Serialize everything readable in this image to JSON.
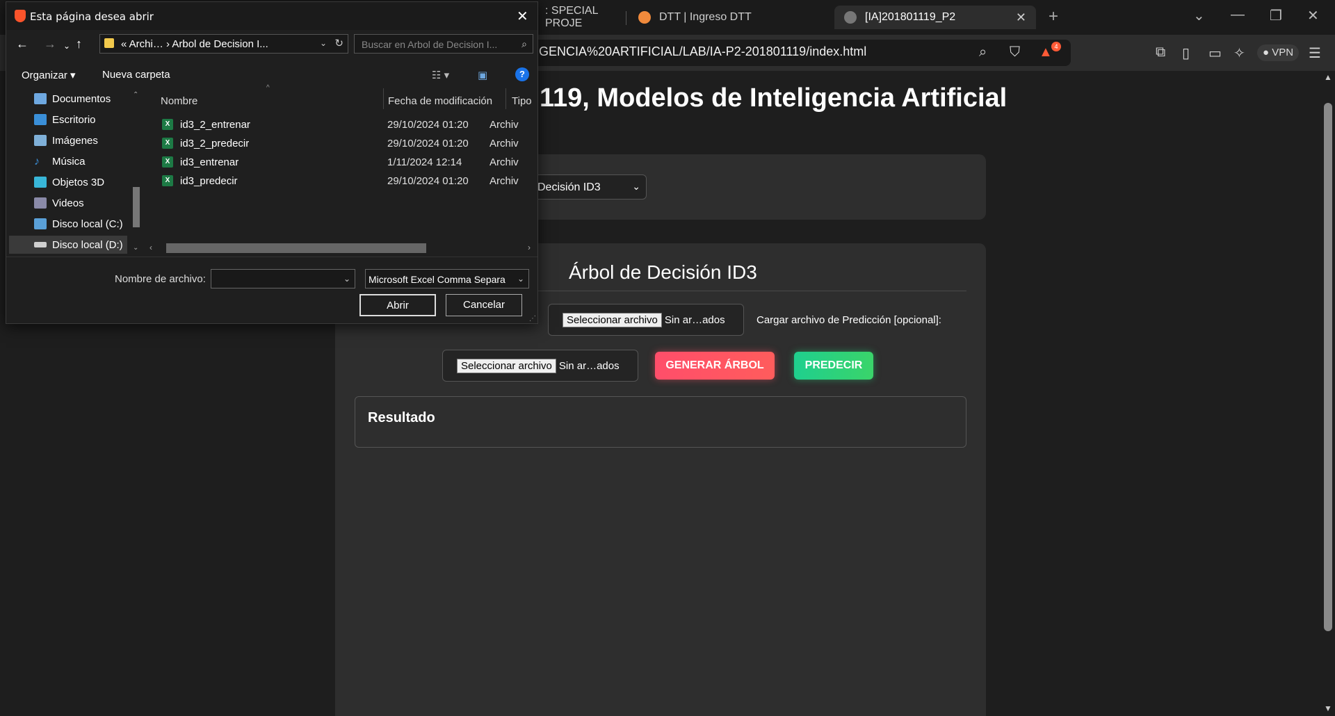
{
  "browser": {
    "tabs": [
      {
        "label": ": SPECIAL PROJE",
        "active": false
      },
      {
        "label": "DTT | Ingreso DTT",
        "active": false
      },
      {
        "label": "[IA]201801119_P2",
        "active": true
      }
    ],
    "url": "GENCIA%20ARTIFICIAL/LAB/IA-P2-201801119/index.html",
    "shields_count": "4",
    "vpn_label": "VPN",
    "icons": [
      "zoom-icon",
      "brave-shield-icon",
      "rewards-icon",
      "extensions-icon",
      "sidebar-icon",
      "wallet-icon",
      "leo-icon",
      "menu-icon"
    ]
  },
  "page": {
    "title": "119, Modelos de Inteligencia Artificial",
    "algorithm_select": "Decisión ID3",
    "section_title": "Árbol de Decisión ID3",
    "file_input_1": {
      "button": "Seleccionar archivo",
      "status": "Sin ar…ados"
    },
    "prediction_label": "Cargar archivo de Predicción [opcional]:",
    "file_input_2": {
      "button": "Seleccionar archivo",
      "status": "Sin ar…ados"
    },
    "btn_generate": "GENERAR ÁRBOL",
    "btn_predict": "PREDECIR",
    "result_title": "Resultado"
  },
  "dialog": {
    "title": "Esta página desea abrir",
    "path": "« Archi…  ›  Arbol de Decision I...",
    "search_placeholder": "Buscar en Arbol de Decision I...",
    "organize": "Organizar ▾",
    "new_folder": "Nueva carpeta",
    "sidebar": [
      {
        "label": "Documentos",
        "color": "#6ea8e0"
      },
      {
        "label": "Escritorio",
        "color": "#3a8fd8"
      },
      {
        "label": "Imágenes",
        "color": "#7fb0d8"
      },
      {
        "label": "Música",
        "color": "#3a8fd8"
      },
      {
        "label": "Objetos 3D",
        "color": "#38b6d8"
      },
      {
        "label": "Videos",
        "color": "#8a8aa8"
      },
      {
        "label": "Disco local (C:)",
        "color": "#5aa0d8"
      },
      {
        "label": "Disco local (D:)",
        "color": "#cfcfcf"
      }
    ],
    "columns": {
      "name": "Nombre",
      "date": "Fecha de modificación",
      "type": "Tipo"
    },
    "files": [
      {
        "name": "id3_2_entrenar",
        "date": "29/10/2024 01:20",
        "type": "Archiv"
      },
      {
        "name": "id3_2_predecir",
        "date": "29/10/2024 01:20",
        "type": "Archiv"
      },
      {
        "name": "id3_entrenar",
        "date": "1/11/2024 12:14",
        "type": "Archiv"
      },
      {
        "name": "id3_predecir",
        "date": "29/10/2024 01:20",
        "type": "Archiv"
      }
    ],
    "filename_label": "Nombre de archivo:",
    "filename_value": "",
    "filetype": "Microsoft Excel Comma Separa",
    "open_button": "Abrir",
    "cancel_button": "Cancelar"
  }
}
